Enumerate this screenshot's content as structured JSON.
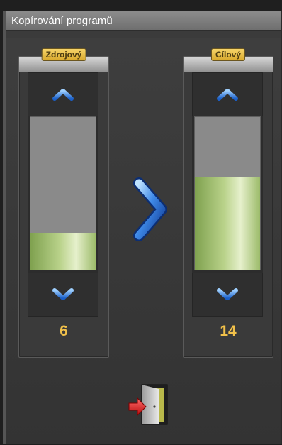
{
  "window": {
    "title": "Kopírování programů"
  },
  "source": {
    "label": "Zdrojový",
    "value": "6",
    "level": 0.24
  },
  "target": {
    "label": "Cílový",
    "value": "14",
    "level": 0.61
  },
  "colors": {
    "accent": "#f2c14a",
    "fill": "#b9d28a",
    "arrow": "#2b6fd6",
    "exit_arrow": "#d62525"
  },
  "icons": {
    "up": "chevron-up-icon",
    "down": "chevron-down-icon",
    "copy": "chevron-right-icon",
    "exit": "exit-door-icon"
  }
}
